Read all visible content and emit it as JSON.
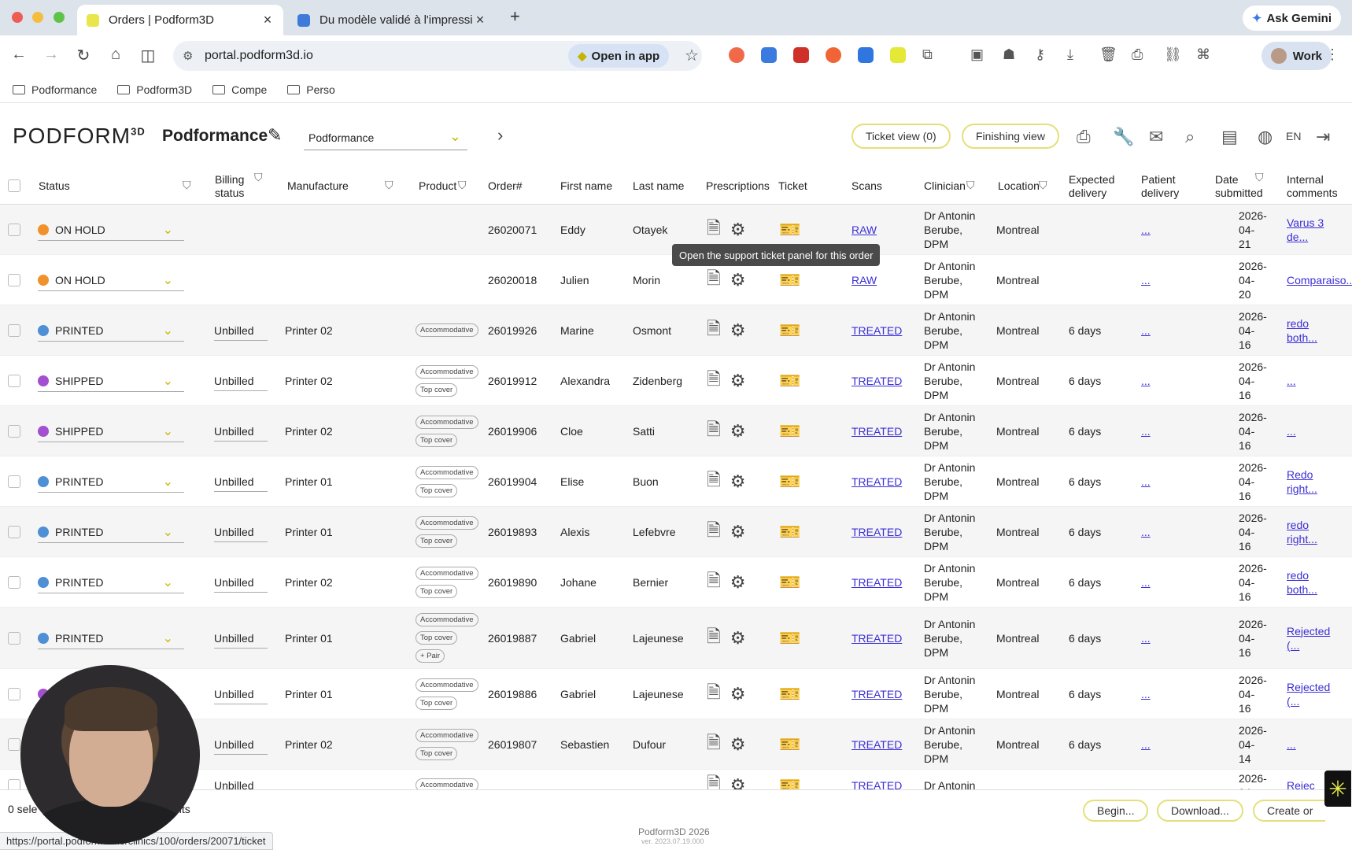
{
  "browser": {
    "tabs": [
      {
        "label": "Orders | Podform3D",
        "close": "×"
      },
      {
        "label": "Du modèle validé à l'impressi",
        "close": "×"
      }
    ],
    "new_tab": "+",
    "ask_gemini": "Ask Gemini",
    "url": "portal.podform3d.io",
    "open_in_app": "Open in app",
    "profile": "Work",
    "bookmarks": [
      "Podformance",
      "Podform3D",
      "Compe",
      "Perso"
    ],
    "status_url": "https://portal.podform3d.io/clinics/100/orders/20071/ticket"
  },
  "app": {
    "logo": "PODFORM",
    "logo_sup": "3D",
    "clinic_name": "Podformance",
    "clinic_select": "Podformance",
    "ticket_view": "Ticket view (0)",
    "finishing_view": "Finishing view",
    "lang": "EN"
  },
  "columns": {
    "status": "Status",
    "billing": "Billing status",
    "manufacture": "Manufacture",
    "product": "Product",
    "order": "Order#",
    "first": "First name",
    "last": "Last name",
    "prescriptions": "Prescriptions",
    "ticket": "Ticket",
    "scans": "Scans",
    "clinician": "Clinician",
    "location": "Location",
    "expected": "Expected delivery",
    "patient": "Patient delivery",
    "date": "Date submitted",
    "comments": "Internal comments"
  },
  "tooltip": "Open the support ticket panel for this order",
  "rows": [
    {
      "status": "ON HOLD",
      "color": "#f0922b",
      "billing": "",
      "manufacture": "",
      "chips": [],
      "order": "26020071",
      "first": "Eddy",
      "last": "Otayek",
      "scan": "RAW",
      "clin1": "Dr Antonin",
      "clin2": "Berube,",
      "clin3": "DPM",
      "location": "Montreal",
      "expected": "",
      "patient": "...",
      "date1": "2026-04-",
      "date2": "21",
      "cmt1": "Varus 3",
      "cmt2": "de..."
    },
    {
      "status": "ON HOLD",
      "color": "#f0922b",
      "billing": "",
      "manufacture": "",
      "chips": [],
      "order": "26020018",
      "first": "Julien",
      "last": "Morin",
      "scan": "RAW",
      "clin1": "Dr Antonin",
      "clin2": "Berube,",
      "clin3": "DPM",
      "location": "Montreal",
      "expected": "",
      "patient": "...",
      "date1": "2026-04-",
      "date2": "20",
      "cmt1": "Comparaiso...",
      "cmt2": ""
    },
    {
      "status": "PRINTED",
      "color": "#4f8fd4",
      "billing": "Unbilled",
      "manufacture": "Printer 02",
      "chips": [
        "Accommodative"
      ],
      "order": "26019926",
      "first": "Marine",
      "last": "Osmont",
      "scan": "TREATED",
      "clin1": "Dr Antonin",
      "clin2": "Berube,",
      "clin3": "DPM",
      "location": "Montreal",
      "expected": "6 days",
      "patient": "...",
      "date1": "2026-04-",
      "date2": "16",
      "cmt1": "redo",
      "cmt2": "both..."
    },
    {
      "status": "SHIPPED",
      "color": "#a24fd0",
      "billing": "Unbilled",
      "manufacture": "Printer 02",
      "chips": [
        "Accommodative",
        "Top cover"
      ],
      "order": "26019912",
      "first": "Alexandra",
      "last": "Zidenberg",
      "scan": "TREATED",
      "clin1": "Dr Antonin",
      "clin2": "Berube,",
      "clin3": "DPM",
      "location": "Montreal",
      "expected": "6 days",
      "patient": "...",
      "date1": "2026-04-",
      "date2": "16",
      "cmt1": "...",
      "cmt2": ""
    },
    {
      "status": "SHIPPED",
      "color": "#a24fd0",
      "billing": "Unbilled",
      "manufacture": "Printer 02",
      "chips": [
        "Accommodative",
        "Top cover"
      ],
      "order": "26019906",
      "first": "Cloe",
      "last": "Satti",
      "scan": "TREATED",
      "clin1": "Dr Antonin",
      "clin2": "Berube,",
      "clin3": "DPM",
      "location": "Montreal",
      "expected": "6 days",
      "patient": "...",
      "date1": "2026-04-",
      "date2": "16",
      "cmt1": "...",
      "cmt2": ""
    },
    {
      "status": "PRINTED",
      "color": "#4f8fd4",
      "billing": "Unbilled",
      "manufacture": "Printer 01",
      "chips": [
        "Accommodative",
        "Top cover"
      ],
      "order": "26019904",
      "first": "Elise",
      "last": "Buon",
      "scan": "TREATED",
      "clin1": "Dr Antonin",
      "clin2": "Berube,",
      "clin3": "DPM",
      "location": "Montreal",
      "expected": "6 days",
      "patient": "...",
      "date1": "2026-04-",
      "date2": "16",
      "cmt1": "Redo",
      "cmt2": "right..."
    },
    {
      "status": "PRINTED",
      "color": "#4f8fd4",
      "billing": "Unbilled",
      "manufacture": "Printer 01",
      "chips": [
        "Accommodative",
        "Top cover"
      ],
      "order": "26019893",
      "first": "Alexis",
      "last": "Lefebvre",
      "scan": "TREATED",
      "clin1": "Dr Antonin",
      "clin2": "Berube,",
      "clin3": "DPM",
      "location": "Montreal",
      "expected": "6 days",
      "patient": "...",
      "date1": "2026-04-",
      "date2": "16",
      "cmt1": "redo",
      "cmt2": "right..."
    },
    {
      "status": "PRINTED",
      "color": "#4f8fd4",
      "billing": "Unbilled",
      "manufacture": "Printer 02",
      "chips": [
        "Accommodative",
        "Top cover"
      ],
      "order": "26019890",
      "first": "Johane",
      "last": "Bernier",
      "scan": "TREATED",
      "clin1": "Dr Antonin",
      "clin2": "Berube,",
      "clin3": "DPM",
      "location": "Montreal",
      "expected": "6 days",
      "patient": "...",
      "date1": "2026-04-",
      "date2": "16",
      "cmt1": "redo",
      "cmt2": "both..."
    },
    {
      "status": "PRINTED",
      "color": "#4f8fd4",
      "billing": "Unbilled",
      "manufacture": "Printer 01",
      "chips": [
        "Accommodative",
        "Top cover",
        "+ Pair"
      ],
      "order": "26019887",
      "first": "Gabriel",
      "last": "Lajeunese",
      "scan": "TREATED",
      "clin1": "Dr Antonin",
      "clin2": "Berube,",
      "clin3": "DPM",
      "location": "Montreal",
      "expected": "6 days",
      "patient": "...",
      "date1": "2026-04-",
      "date2": "16",
      "cmt1": "Rejected",
      "cmt2": "(..."
    },
    {
      "status": "",
      "color": "#a24fd0",
      "billing": "Unbilled",
      "manufacture": "Printer 01",
      "chips": [
        "Accommodative",
        "Top cover"
      ],
      "order": "26019886",
      "first": "Gabriel",
      "last": "Lajeunese",
      "scan": "TREATED",
      "clin1": "Dr Antonin",
      "clin2": "Berube,",
      "clin3": "DPM",
      "location": "Montreal",
      "expected": "6 days",
      "patient": "...",
      "date1": "2026-04-",
      "date2": "16",
      "cmt1": "Rejected",
      "cmt2": "(..."
    },
    {
      "status": "",
      "color": "#4f8fd4",
      "billing": "Unbilled",
      "manufacture": "Printer 02",
      "chips": [
        "Accommodative",
        "Top cover"
      ],
      "order": "26019807",
      "first": "Sebastien",
      "last": "Dufour",
      "scan": "TREATED",
      "clin1": "Dr Antonin",
      "clin2": "Berube,",
      "clin3": "DPM",
      "location": "Montreal",
      "expected": "6 days",
      "patient": "...",
      "date1": "2026-04-",
      "date2": "14",
      "cmt1": "...",
      "cmt2": ""
    },
    {
      "status": "",
      "color": "#4f8fd4",
      "billing": "Unbilled",
      "manufacture": "",
      "chips": [
        "Accommodative"
      ],
      "order": "",
      "first": "",
      "last": "",
      "scan": "TREATED",
      "clin1": "Dr Antonin",
      "clin2": "",
      "clin3": "",
      "location": "",
      "expected": "",
      "patient": "",
      "date1": "2026-04-",
      "date2": "",
      "cmt1": "Rejec",
      "cmt2": ""
    }
  ],
  "footer": {
    "selected": "0 sele",
    "results": "ults",
    "begin": "Begin...",
    "download": "Download...",
    "create": "Create or",
    "copyright": "Podform3D 2026",
    "version": "ver. 2023.07.19.000"
  }
}
